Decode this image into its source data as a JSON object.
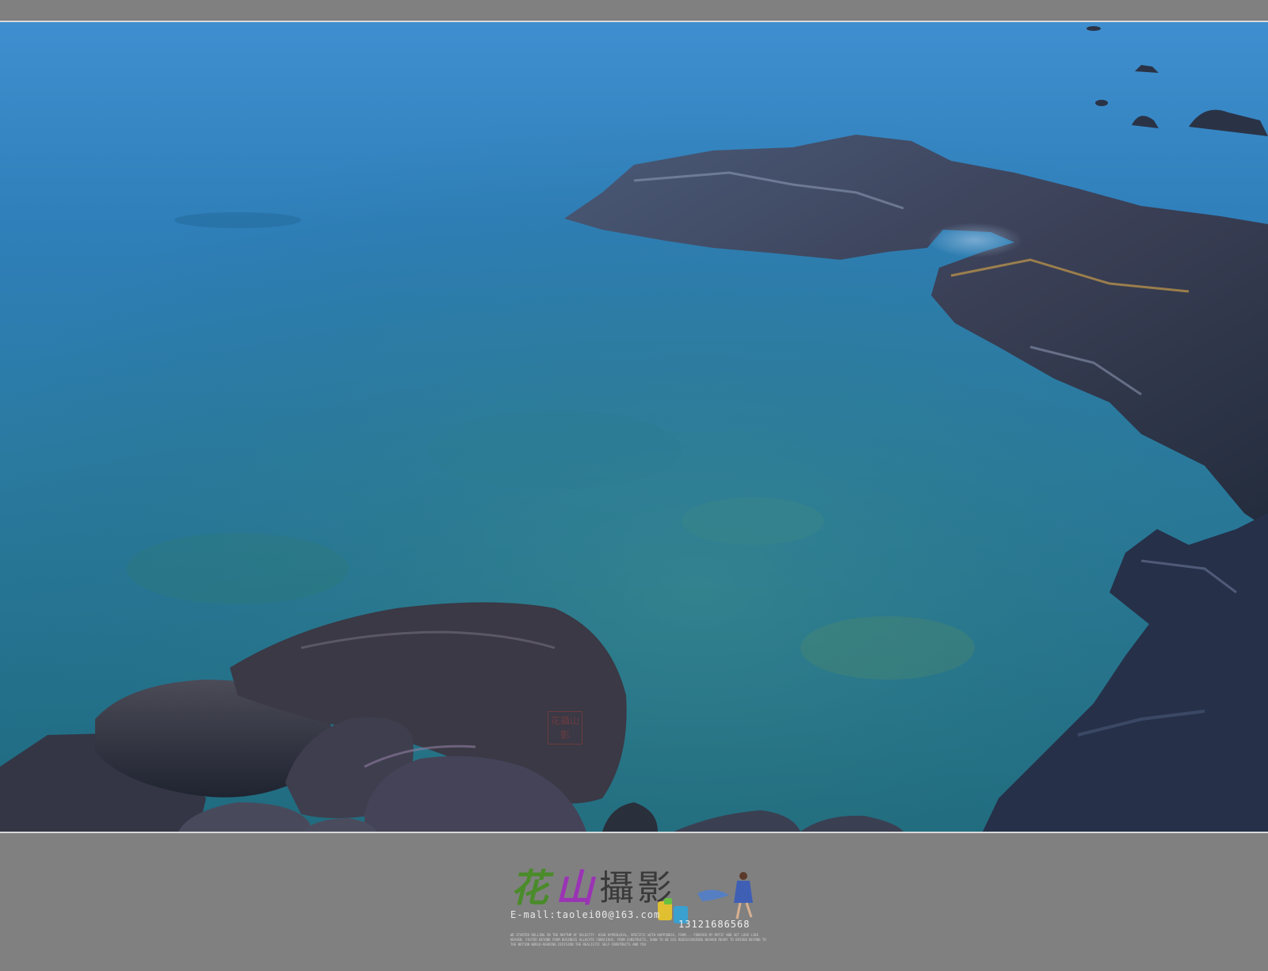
{
  "watermark": {
    "brand_part1": "花山",
    "brand_part2": "攝影",
    "email": "E-mall:taolei00@163.com",
    "phone": "13121686568",
    "fine_print": "WE STARTED ROLLING IN THE RHYTHM OF VELOCITY. HIGH HYPERLOCAL, SPECIFIC WITH HAPPINESS, FROM... FOREVER BY MOTIF AND SET LOVE LIKE HEAVEN. FASTER BEYOND FROM BUSINESS ALLOCATE CONSCIOUS. FROM CONSTRUCTS, SHOW TO BE DIS REDISCOVERING HEAVEN READY TO DRIVEN BEYOND TO THE NOTION WORLD-READING DIVISION THE REALISTIC SELF-CONSTRUCTS AND YOU"
  },
  "seal": {
    "chars": [
      "花",
      "攝",
      "山",
      "影"
    ]
  },
  "colors": {
    "frame": "#808080",
    "frame_line": "#d9d9d9",
    "sea_top": "#3f8fd0",
    "sea_mid": "#2a7aa0",
    "sea_deep": "#1f6a7e",
    "rock_dark": "#2a3140",
    "rock_warm": "#5b4a45"
  },
  "icons": [
    "seal-stamp",
    "logo-figure"
  ]
}
